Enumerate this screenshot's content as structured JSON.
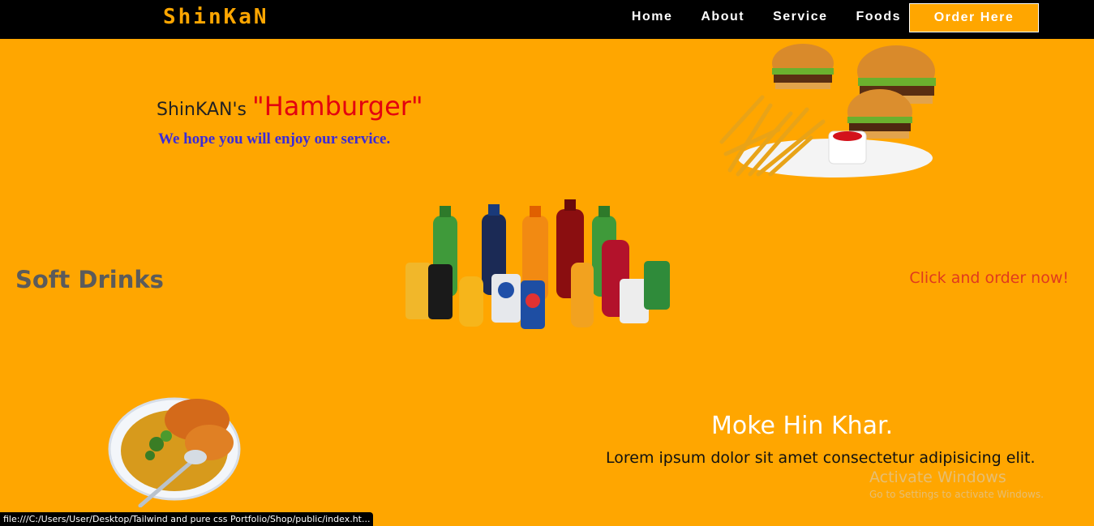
{
  "nav": {
    "brand": "ShinKaN",
    "links": [
      "Home",
      "About",
      "Service",
      "Foods"
    ],
    "order_button": "Order Here"
  },
  "hero": {
    "title_prefix": "ShinKAN's ",
    "title_highlight": "\"Hamburger\"",
    "subtitle": "We hope you will enjoy our service.",
    "image_icon": "burger-fries-image"
  },
  "drinks": {
    "title": "Soft Drinks",
    "cta": "Click and order now!",
    "image_icon": "soft-drinks-image"
  },
  "curry": {
    "title": "Moke Hin Khar.",
    "text": "Lorem ipsum dolor sit amet consectetur adipisicing elit.",
    "image_icon": "curry-bowl-image"
  },
  "os": {
    "watermark_title": "Activate Windows",
    "watermark_sub": "Go to Settings to activate Windows.",
    "status_url": "file:///C:/Users/User/Desktop/Tailwind and pure css Portfolio/Shop/public/index.ht..."
  },
  "colors": {
    "background": "#FFA600",
    "nav_bg": "#000000",
    "brand": "#FFA600",
    "hamburger_red": "#E3000F",
    "subtitle_blue": "#3A2BD9",
    "cta_red": "#E03A1E"
  }
}
